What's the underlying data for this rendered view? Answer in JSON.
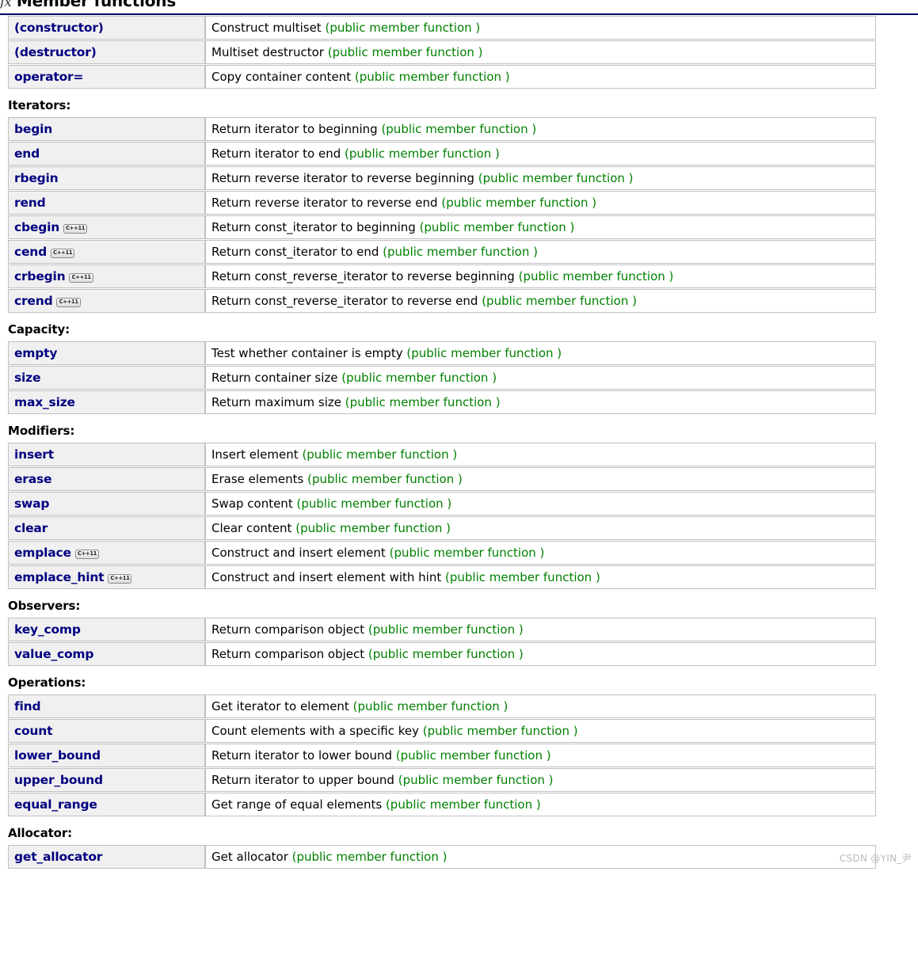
{
  "header": {
    "icon": "fx-icon",
    "icon_glyph": "ƒx",
    "title": "Member functions",
    "rule_color": "#000060"
  },
  "colors": {
    "link": "#000080",
    "kind_green": "#008000",
    "name_cell_bg": "#f0f0f0",
    "border": "#c0c0c0",
    "watermark": "#bbbbbb"
  },
  "badge_label": "C++11",
  "sections": [
    {
      "heading": "",
      "rows": [
        {
          "name": "(constructor)",
          "badge": false,
          "desc": "Construct multiset",
          "kind": "(public member function )"
        },
        {
          "name": "(destructor)",
          "badge": false,
          "desc": "Multiset destructor",
          "kind": "(public member function )"
        },
        {
          "name": "operator=",
          "badge": false,
          "desc": "Copy container content",
          "kind": "(public member function )"
        }
      ]
    },
    {
      "heading": "Iterators:",
      "rows": [
        {
          "name": "begin",
          "badge": false,
          "desc": "Return iterator to beginning",
          "kind": "(public member function )"
        },
        {
          "name": "end",
          "badge": false,
          "desc": "Return iterator to end",
          "kind": "(public member function )"
        },
        {
          "name": "rbegin",
          "badge": false,
          "desc": "Return reverse iterator to reverse beginning",
          "kind": "(public member function )"
        },
        {
          "name": "rend",
          "badge": false,
          "desc": "Return reverse iterator to reverse end",
          "kind": "(public member function )"
        },
        {
          "name": "cbegin",
          "badge": true,
          "desc": "Return const_iterator to beginning",
          "kind": "(public member function )"
        },
        {
          "name": "cend",
          "badge": true,
          "desc": "Return const_iterator to end",
          "kind": "(public member function )"
        },
        {
          "name": "crbegin",
          "badge": true,
          "desc": "Return const_reverse_iterator to reverse beginning",
          "kind": "(public member function )"
        },
        {
          "name": "crend",
          "badge": true,
          "desc": "Return const_reverse_iterator to reverse end",
          "kind": "(public member function )"
        }
      ]
    },
    {
      "heading": "Capacity:",
      "rows": [
        {
          "name": "empty",
          "badge": false,
          "desc": "Test whether container is empty",
          "kind": "(public member function )"
        },
        {
          "name": "size",
          "badge": false,
          "desc": "Return container size",
          "kind": "(public member function )"
        },
        {
          "name": "max_size",
          "badge": false,
          "desc": "Return maximum size",
          "kind": "(public member function )"
        }
      ]
    },
    {
      "heading": "Modifiers:",
      "rows": [
        {
          "name": "insert",
          "badge": false,
          "desc": "Insert element",
          "kind": "(public member function )"
        },
        {
          "name": "erase",
          "badge": false,
          "desc": "Erase elements",
          "kind": "(public member function )"
        },
        {
          "name": "swap",
          "badge": false,
          "desc": "Swap content",
          "kind": "(public member function )"
        },
        {
          "name": "clear",
          "badge": false,
          "desc": "Clear content",
          "kind": "(public member function )"
        },
        {
          "name": "emplace",
          "badge": true,
          "desc": "Construct and insert element",
          "kind": "(public member function )"
        },
        {
          "name": "emplace_hint",
          "badge": true,
          "desc": "Construct and insert element with hint",
          "kind": "(public member function )"
        }
      ]
    },
    {
      "heading": "Observers:",
      "rows": [
        {
          "name": "key_comp",
          "badge": false,
          "desc": "Return comparison object",
          "kind": "(public member function )"
        },
        {
          "name": "value_comp",
          "badge": false,
          "desc": "Return comparison object",
          "kind": "(public member function )"
        }
      ]
    },
    {
      "heading": "Operations:",
      "rows": [
        {
          "name": "find",
          "badge": false,
          "desc": "Get iterator to element",
          "kind": "(public member function )"
        },
        {
          "name": "count",
          "badge": false,
          "desc": "Count elements with a specific key",
          "kind": "(public member function )"
        },
        {
          "name": "lower_bound",
          "badge": false,
          "desc": "Return iterator to lower bound",
          "kind": "(public member function )"
        },
        {
          "name": "upper_bound",
          "badge": false,
          "desc": "Return iterator to upper bound",
          "kind": "(public member function )"
        },
        {
          "name": "equal_range",
          "badge": false,
          "desc": "Get range of equal elements",
          "kind": "(public member function )"
        }
      ]
    },
    {
      "heading": "Allocator:",
      "rows": [
        {
          "name": "get_allocator",
          "badge": false,
          "desc": "Get allocator",
          "kind": "(public member function )"
        }
      ]
    }
  ],
  "watermark": "CSDN @YIN_尹"
}
